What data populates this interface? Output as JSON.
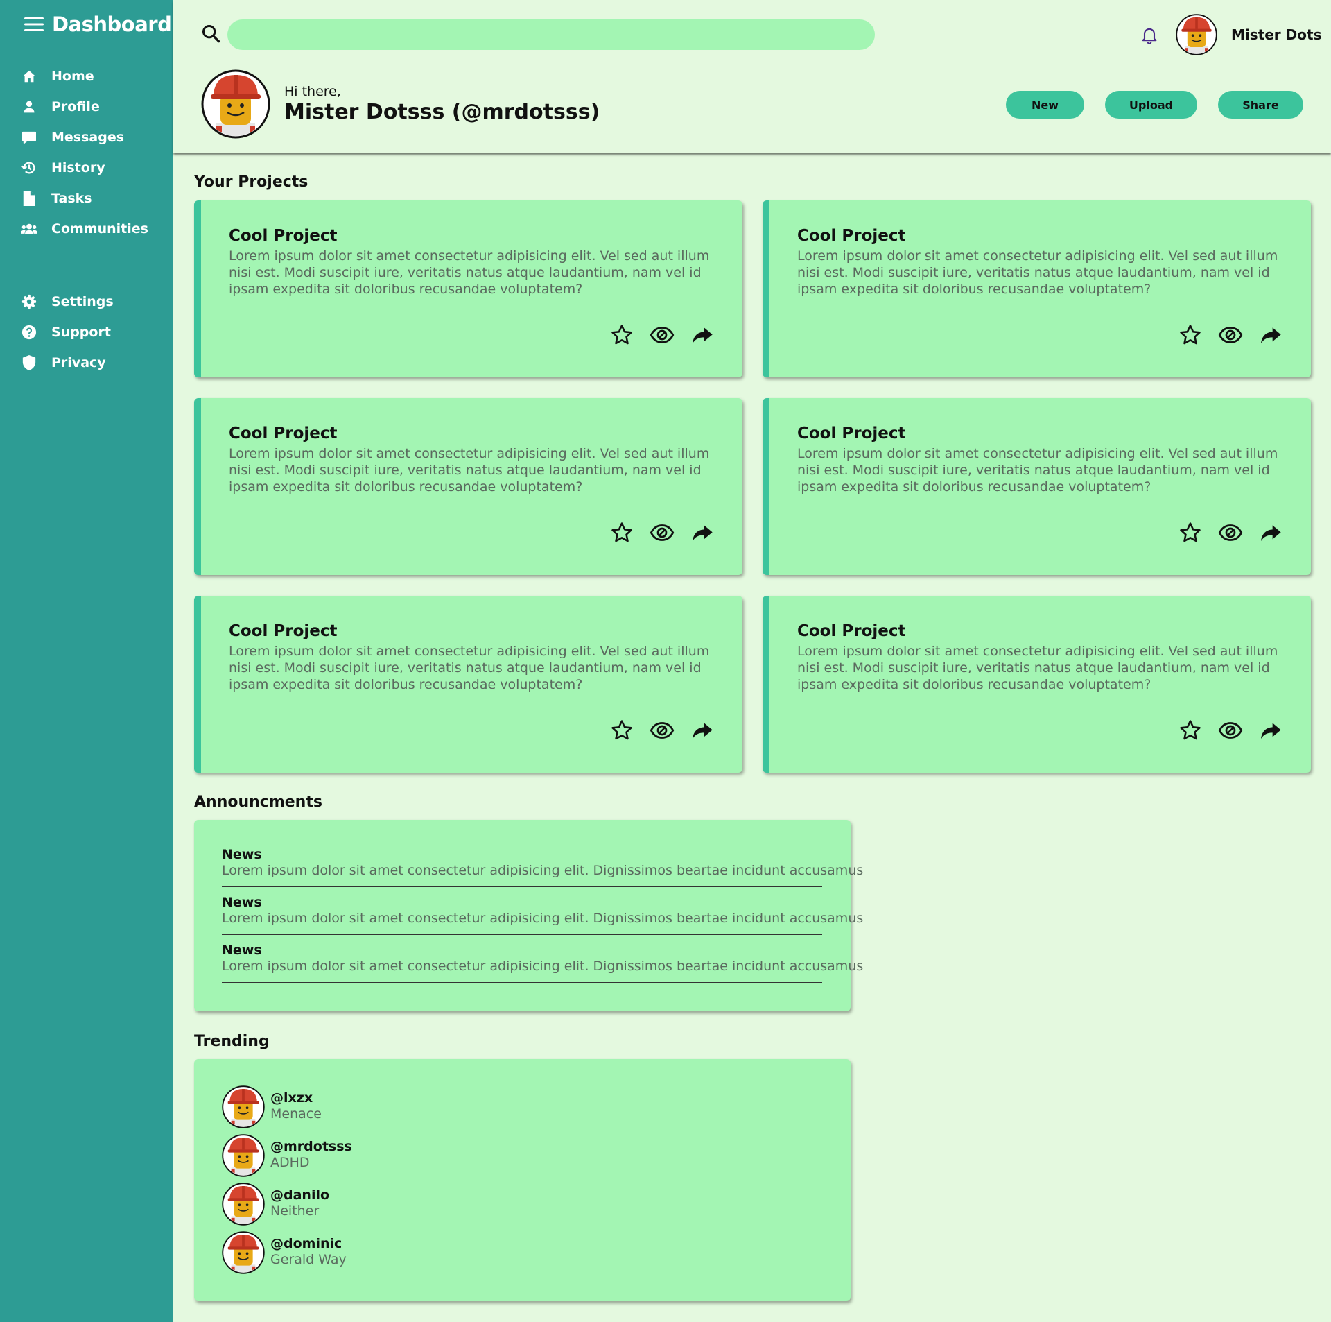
{
  "sidebar": {
    "title": "Dashboard",
    "items": [
      {
        "label": "Home",
        "icon": "home-icon"
      },
      {
        "label": "Profile",
        "icon": "user-icon"
      },
      {
        "label": "Messages",
        "icon": "message-icon"
      },
      {
        "label": "History",
        "icon": "history-icon"
      },
      {
        "label": "Tasks",
        "icon": "file-icon"
      },
      {
        "label": "Communities",
        "icon": "users-icon"
      }
    ],
    "bottom_items": [
      {
        "label": "Settings",
        "icon": "gear-icon"
      },
      {
        "label": "Support",
        "icon": "question-icon"
      },
      {
        "label": "Privacy",
        "icon": "shield-icon"
      }
    ]
  },
  "header": {
    "search_placeholder": "",
    "username": "Mister Dots",
    "greeting": "Hi there,",
    "fullname": "Mister Dotsss (@mrdotsss)",
    "buttons": {
      "new": "New",
      "upload": "Upload",
      "share": "Share"
    }
  },
  "projects": {
    "title": "Your Projects",
    "items": [
      {
        "title": "Cool Project",
        "description": "Lorem ipsum dolor sit amet consectetur adipisicing elit. Vel sed aut illum nisi est. Modi suscipit iure, veritatis natus atque laudantium, nam vel id ipsam expedita sit doloribus recusandae voluptatem?"
      },
      {
        "title": "Cool Project",
        "description": "Lorem ipsum dolor sit amet consectetur adipisicing elit. Vel sed aut illum nisi est. Modi suscipit iure, veritatis natus atque laudantium, nam vel id ipsam expedita sit doloribus recusandae voluptatem?"
      },
      {
        "title": "Cool Project",
        "description": "Lorem ipsum dolor sit amet consectetur adipisicing elit. Vel sed aut illum nisi est. Modi suscipit iure, veritatis natus atque laudantium, nam vel id ipsam expedita sit doloribus recusandae voluptatem?"
      },
      {
        "title": "Cool Project",
        "description": "Lorem ipsum dolor sit amet consectetur adipisicing elit. Vel sed aut illum nisi est. Modi suscipit iure, veritatis natus atque laudantium, nam vel id ipsam expedita sit doloribus recusandae voluptatem?"
      },
      {
        "title": "Cool Project",
        "description": "Lorem ipsum dolor sit amet consectetur adipisicing elit. Vel sed aut illum nisi est. Modi suscipit iure, veritatis natus atque laudantium, nam vel id ipsam expedita sit doloribus recusandae voluptatem?"
      },
      {
        "title": "Cool Project",
        "description": "Lorem ipsum dolor sit amet consectetur adipisicing elit. Vel sed aut illum nisi est. Modi suscipit iure, veritatis natus atque laudantium, nam vel id ipsam expedita sit doloribus recusandae voluptatem?"
      }
    ]
  },
  "announcements": {
    "title": "Announcments",
    "items": [
      {
        "title": "News",
        "text": "Lorem ipsum dolor sit amet consectetur adipisicing elit. Dignissimos beartae incidunt accusamus"
      },
      {
        "title": "News",
        "text": "Lorem ipsum dolor sit amet consectetur adipisicing elit. Dignissimos beartae incidunt accusamus"
      },
      {
        "title": "News",
        "text": "Lorem ipsum dolor sit amet consectetur adipisicing elit. Dignissimos beartae incidunt accusamus"
      }
    ]
  },
  "trending": {
    "title": "Trending",
    "items": [
      {
        "handle": "@lxzx",
        "subtitle": "Menace"
      },
      {
        "handle": "@mrdotsss",
        "subtitle": "ADHD"
      },
      {
        "handle": "@danilo",
        "subtitle": "Neither"
      },
      {
        "handle": "@dominic",
        "subtitle": "Gerald Way"
      }
    ]
  },
  "colors": {
    "sidebar": "#2d9c94",
    "background": "#e4f9df",
    "card": "#a3f5b3",
    "accent": "#3cc49c"
  }
}
